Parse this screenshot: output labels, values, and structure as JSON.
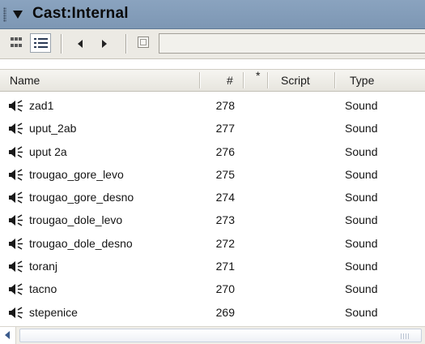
{
  "panel": {
    "title": "Cast:Internal"
  },
  "toolbar": {
    "thumbnail_view_icon": "thumbnail-view-icon",
    "list_view_icon": "list-view-icon",
    "previous_icon": "previous-arrow-icon",
    "next_icon": "next-arrow-icon",
    "member_icon": "cast-member-icon",
    "member_name_value": ""
  },
  "columns": {
    "name": "Name",
    "number": "#",
    "flag": "*",
    "script": "Script",
    "type": "Type"
  },
  "rows": [
    {
      "name": "zad1",
      "number": "278",
      "type": "Sound",
      "icon": "sound-icon"
    },
    {
      "name": "uput_2ab",
      "number": "277",
      "type": "Sound",
      "icon": "sound-icon"
    },
    {
      "name": "uput 2a",
      "number": "276",
      "type": "Sound",
      "icon": "sound-icon"
    },
    {
      "name": "trougao_gore_levo",
      "number": "275",
      "type": "Sound",
      "icon": "sound-icon"
    },
    {
      "name": "trougao_gore_desno",
      "number": "274",
      "type": "Sound",
      "icon": "sound-icon"
    },
    {
      "name": "trougao_dole_levo",
      "number": "273",
      "type": "Sound",
      "icon": "sound-icon"
    },
    {
      "name": "trougao_dole_desno",
      "number": "272",
      "type": "Sound",
      "icon": "sound-icon"
    },
    {
      "name": "toranj",
      "number": "271",
      "type": "Sound",
      "icon": "sound-icon"
    },
    {
      "name": "tacno",
      "number": "270",
      "type": "Sound",
      "icon": "sound-icon"
    },
    {
      "name": "stepenice",
      "number": "269",
      "type": "Sound",
      "icon": "sound-icon"
    }
  ],
  "colors": {
    "title_bar": "#8aa3bf",
    "toolbar": "#eceae4",
    "header": "#ece9e1"
  }
}
